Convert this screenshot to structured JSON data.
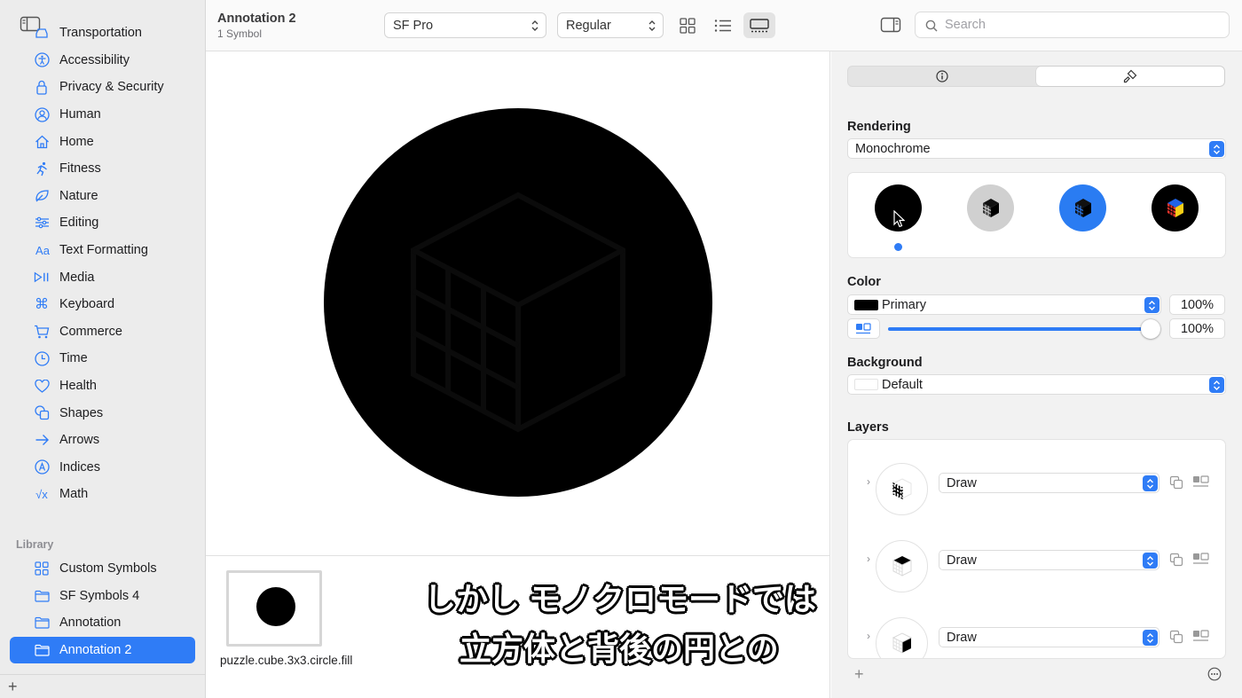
{
  "toolbar": {
    "doc_title": "Annotation 2",
    "doc_subtitle": "1 Symbol",
    "font": "SF Pro",
    "weight": "Regular",
    "search_placeholder": "Search"
  },
  "sidebar": {
    "categories": [
      {
        "label": "Transportation",
        "icon": "car-icon"
      },
      {
        "label": "Accessibility",
        "icon": "accessibility-icon"
      },
      {
        "label": "Privacy & Security",
        "icon": "lock-icon"
      },
      {
        "label": "Human",
        "icon": "person-icon"
      },
      {
        "label": "Home",
        "icon": "house-icon"
      },
      {
        "label": "Fitness",
        "icon": "figure-run-icon"
      },
      {
        "label": "Nature",
        "icon": "leaf-icon"
      },
      {
        "label": "Editing",
        "icon": "slider-icon"
      },
      {
        "label": "Text Formatting",
        "icon": "textformat-icon"
      },
      {
        "label": "Media",
        "icon": "play-pause-icon"
      },
      {
        "label": "Keyboard",
        "icon": "command-icon"
      },
      {
        "label": "Commerce",
        "icon": "cart-icon"
      },
      {
        "label": "Time",
        "icon": "clock-icon"
      },
      {
        "label": "Health",
        "icon": "heart-icon"
      },
      {
        "label": "Shapes",
        "icon": "shapes-icon"
      },
      {
        "label": "Arrows",
        "icon": "arrow-right-icon"
      },
      {
        "label": "Indices",
        "icon": "a-circle-icon"
      },
      {
        "label": "Math",
        "icon": "sqrt-icon"
      }
    ],
    "library_heading": "Library",
    "library": [
      {
        "label": "Custom Symbols",
        "icon": "grid-icon"
      },
      {
        "label": "SF Symbols 4",
        "icon": "folder-icon"
      },
      {
        "label": "Annotation",
        "icon": "folder-icon"
      },
      {
        "label": "Annotation 2",
        "icon": "folder-icon",
        "selected": true
      }
    ]
  },
  "gallery": {
    "symbol_name": "puzzle.cube.3x3.circle.fill"
  },
  "captions": {
    "line1": "しかし モノクロモードでは",
    "line2": "立方体と背後の円との"
  },
  "inspector": {
    "rendering_heading": "Rendering",
    "rendering_mode": "Monochrome",
    "modes": [
      "Monochrome",
      "Hierarchical",
      "Palette",
      "Multicolor"
    ],
    "selected_mode": "Monochrome",
    "color_heading": "Color",
    "color_value": "Primary",
    "color_swatch": "#000000",
    "color_opacity": "100%",
    "slider_value": "100%",
    "slider_level": 1.0,
    "background_heading": "Background",
    "background_value": "Default",
    "layers_heading": "Layers",
    "layers": [
      {
        "mode": "Draw",
        "icon": "cube-front-grid-icon"
      },
      {
        "mode": "Draw",
        "icon": "cube-top-icon"
      },
      {
        "mode": "Draw",
        "icon": "cube-side-icon"
      }
    ]
  },
  "colors": {
    "accent": "#2f7cf6",
    "symbol": "#000000"
  }
}
